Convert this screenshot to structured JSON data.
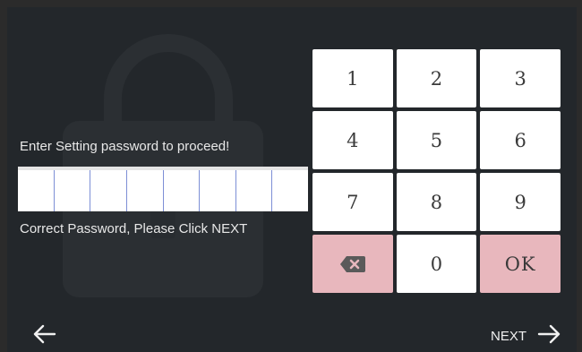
{
  "prompt": "Enter Setting password to proceed!",
  "status": "Correct Password, Please Click NEXT",
  "keypad": {
    "keys": [
      "1",
      "2",
      "3",
      "4",
      "5",
      "6",
      "7",
      "8",
      "9",
      "",
      "0",
      "OK"
    ],
    "backspace_icon": "backspace-icon"
  },
  "nav": {
    "back_icon": "arrow-left-icon",
    "next_label": "NEXT",
    "next_icon": "arrow-right-icon"
  },
  "colors": {
    "background": "#23272b",
    "key": "#ffffff",
    "key_danger": "#e8b7bd",
    "cell_divider": "#7d8fd6"
  }
}
